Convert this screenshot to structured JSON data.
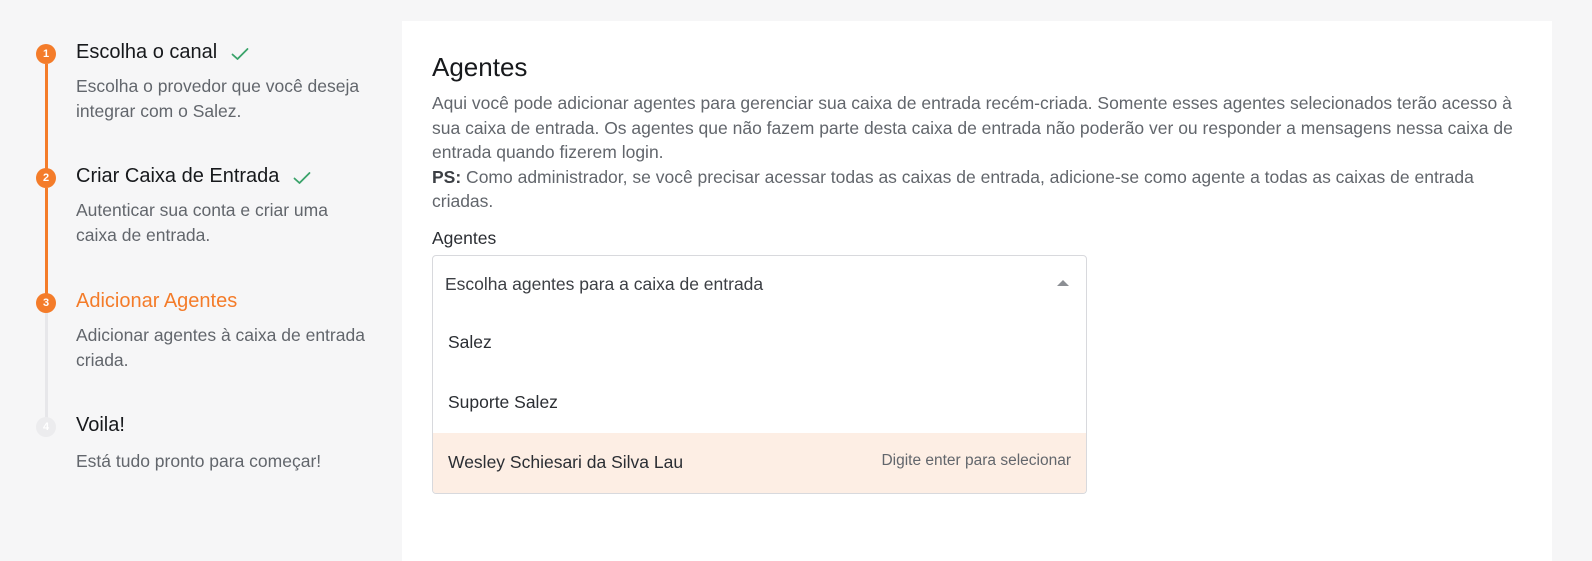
{
  "wizard": {
    "steps": [
      {
        "number": "1",
        "title": "Escolha o canal",
        "description": "Escolha o provedor que você deseja integrar com o Salez.",
        "status": "done"
      },
      {
        "number": "2",
        "title": "Criar Caixa de Entrada",
        "description": "Autenticar sua conta e criar uma caixa de entrada.",
        "status": "done"
      },
      {
        "number": "3",
        "title": "Adicionar Agentes",
        "description": "Adicionar agentes à caixa de entrada criada.",
        "status": "active"
      },
      {
        "number": "4",
        "title": "Voila!",
        "description": "Está tudo pronto para começar!",
        "status": "todo"
      }
    ]
  },
  "panel": {
    "title": "Agentes",
    "description": "Aqui você pode adicionar agentes para gerenciar sua caixa de entrada recém-criada. Somente esses agentes selecionados terão acesso à sua caixa de entrada. Os agentes que não fazem parte desta caixa de entrada não poderão ver ou responder a mensagens nessa caixa de entrada quando fizerem login.",
    "ps_label": "PS:",
    "ps_text": " Como administrador, se você precisar acessar todas as caixas de entrada, adicione-se como agente a todas as caixas de entrada criadas.",
    "field_label": "Agentes",
    "select_placeholder": "Escolha agentes para a caixa de entrada",
    "options": [
      {
        "label": "Salez"
      },
      {
        "label": "Suporte Salez"
      },
      {
        "label": "Wesley Schiesari da Silva Lau"
      }
    ],
    "highlight_hint": "Digite enter para selecionar"
  },
  "colors": {
    "accent": "#f47c2a",
    "check": "#3aa36a",
    "highlight_bg": "#fdeee4"
  }
}
